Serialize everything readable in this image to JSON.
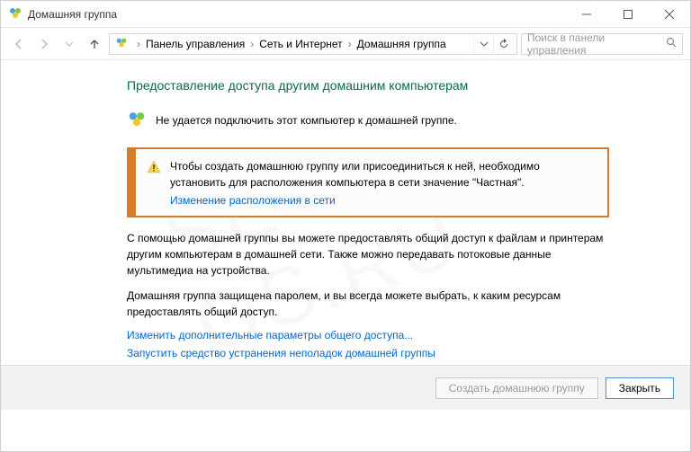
{
  "window": {
    "title": "Домашняя группа"
  },
  "breadcrumb": {
    "items": [
      "Панель управления",
      "Сеть и Интернет",
      "Домашняя группа"
    ]
  },
  "search": {
    "placeholder": "Поиск в панели управления"
  },
  "page": {
    "heading": "Предоставление доступа другим домашним компьютерам",
    "status": "Не удается подключить этот компьютер к домашней группе.",
    "info_text": "Чтобы создать домашнюю группу или присоединиться к ней, необходимо установить для расположения компьютера в сети значение \"Частная\".",
    "info_link": "Изменение расположения в сети",
    "para1": "С помощью домашней группы вы можете предоставлять общий доступ к файлам и принтерам другим компьютерам в домашней сети. Также можно передавать потоковые данные мультимедиа на устройства.",
    "para2": "Домашняя группа защищена паролем, и вы всегда можете выбрать, к каким ресурсам предоставлять общий доступ.",
    "link1": "Изменить дополнительные параметры общего доступа...",
    "link2": "Запустить средство устранения неполадок домашней группы"
  },
  "footer": {
    "create": "Создать домашнюю группу",
    "close": "Закрыть"
  },
  "icons": {
    "homegroup": "homegroup-icon",
    "warning": "warning-icon",
    "back": "back-arrow-icon",
    "forward": "forward-arrow-icon",
    "up": "up-arrow-icon",
    "refresh": "refresh-icon",
    "history": "history-dropdown-icon",
    "search": "search-icon",
    "min": "minimize-icon",
    "max": "maximize-icon",
    "close": "close-icon"
  },
  "watermark": "SET-OS.RU"
}
